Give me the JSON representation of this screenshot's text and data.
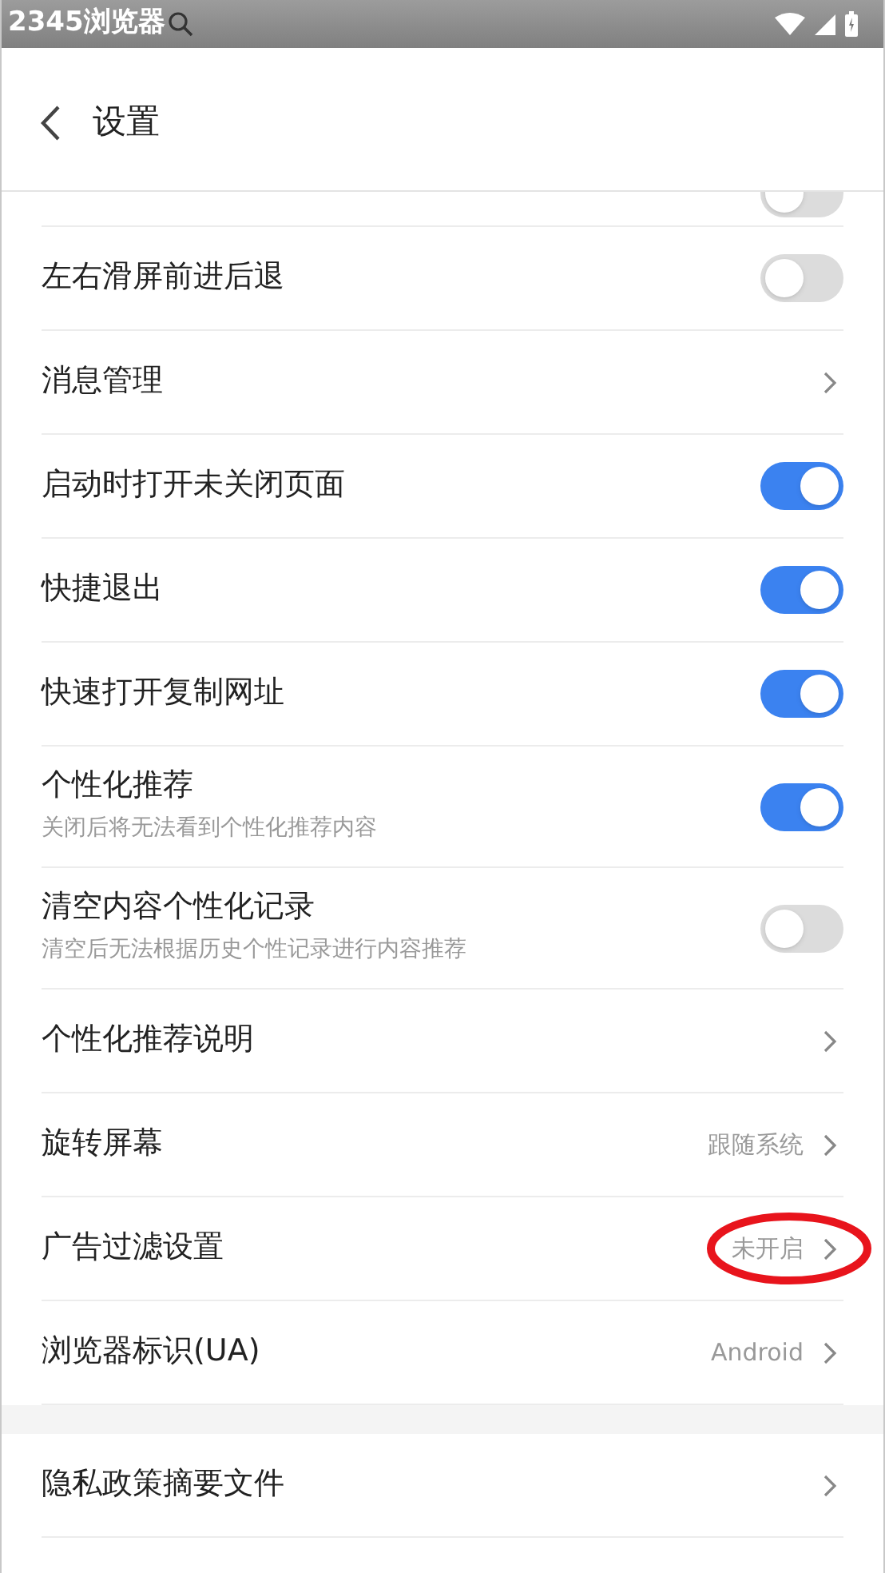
{
  "status_bar": {
    "app_label": "2345浏览器"
  },
  "header": {
    "title": "设置"
  },
  "partial_row": {
    "on": false
  },
  "rows": [
    {
      "kind": "toggle",
      "label": "左右滑屏前进后退",
      "on": false
    },
    {
      "kind": "link",
      "label": "消息管理"
    },
    {
      "kind": "toggle",
      "label": "启动时打开未关闭页面",
      "on": true
    },
    {
      "kind": "toggle",
      "label": "快捷退出",
      "on": true
    },
    {
      "kind": "toggle",
      "label": "快速打开复制网址",
      "on": true
    },
    {
      "kind": "toggle",
      "label": "个性化推荐",
      "subtitle": "关闭后将无法看到个性化推荐内容",
      "on": true
    },
    {
      "kind": "toggle",
      "label": "清空内容个性化记录",
      "subtitle": "清空后无法根据历史个性记录进行内容推荐",
      "on": false
    },
    {
      "kind": "link",
      "label": "个性化推荐说明"
    },
    {
      "kind": "link",
      "label": "旋转屏幕",
      "value": "跟随系统"
    },
    {
      "kind": "link",
      "label": "广告过滤设置",
      "value": "未开启",
      "circled": true
    },
    {
      "kind": "link",
      "label": "浏览器标识(UA)",
      "value": "Android"
    }
  ],
  "rows_2": [
    {
      "kind": "link",
      "label": "隐私政策摘要文件"
    }
  ]
}
